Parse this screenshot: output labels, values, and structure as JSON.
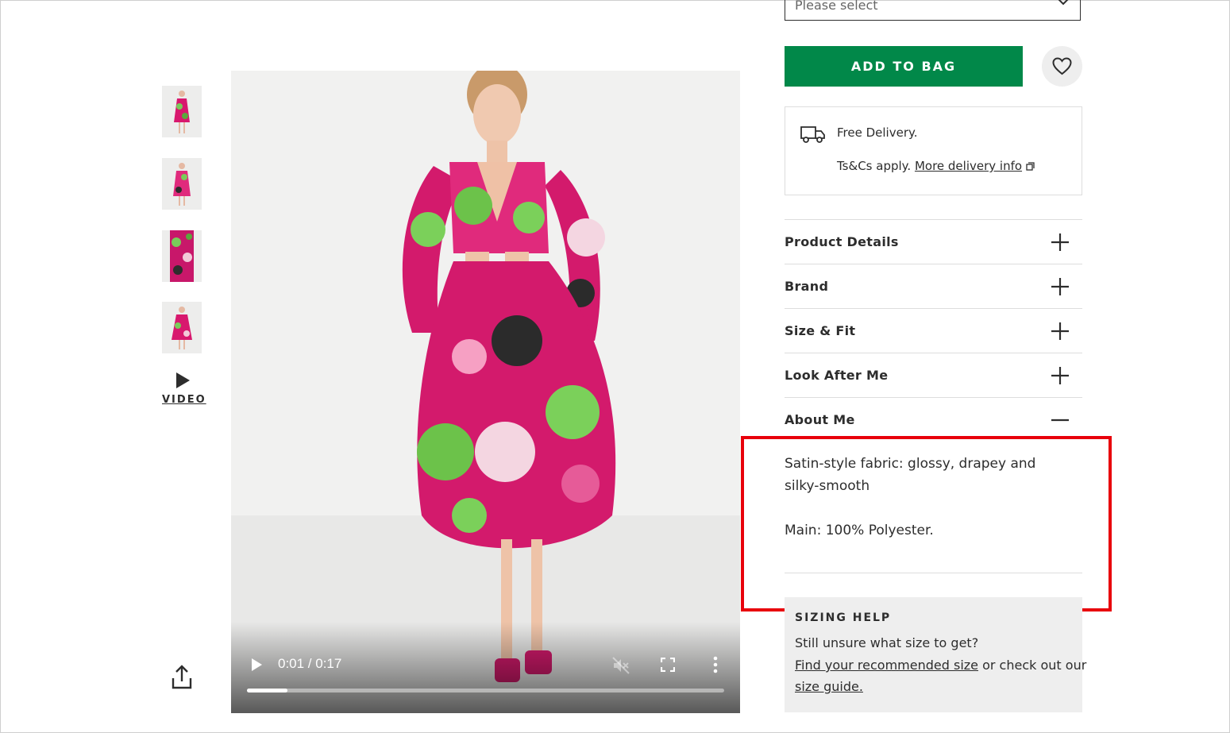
{
  "gallery": {
    "thumbnails": [
      "thumbnail-1",
      "thumbnail-2",
      "thumbnail-3",
      "thumbnail-4"
    ],
    "video_label": "VIDEO",
    "icons": {
      "play": "play-icon",
      "share": "share-icon"
    }
  },
  "video": {
    "time": "0:01 / 0:17",
    "progress": 0.085,
    "icons": [
      "play-icon",
      "muted-icon",
      "fullscreen-icon",
      "more-options-icon"
    ]
  },
  "size_select": {
    "value": "Please select"
  },
  "cart": {
    "add_label": "ADD TO BAG",
    "save_icon": "heart-icon",
    "accent": "#018849"
  },
  "delivery": {
    "title": "Free Delivery.",
    "terms": "Ts&Cs apply.",
    "link": "More delivery info",
    "icon": "truck-icon"
  },
  "accordion": [
    {
      "label": "Product Details",
      "state": "collapsed"
    },
    {
      "label": "Brand",
      "state": "collapsed"
    },
    {
      "label": "Size & Fit",
      "state": "collapsed"
    },
    {
      "label": "Look After Me",
      "state": "collapsed"
    },
    {
      "label": "About Me",
      "state": "expanded"
    }
  ],
  "about_me": {
    "description": "Satin-style fabric: glossy, drapey and silky-smooth",
    "composition": "Main: 100% Polyester."
  },
  "sizing_help": {
    "title": "SIZING HELP",
    "question": "Still unsure what size to get?",
    "recommend_link": "Find your recommended size",
    "middle": " or check out our",
    "guide_link": "size guide."
  },
  "highlight_color": "#e8000b"
}
